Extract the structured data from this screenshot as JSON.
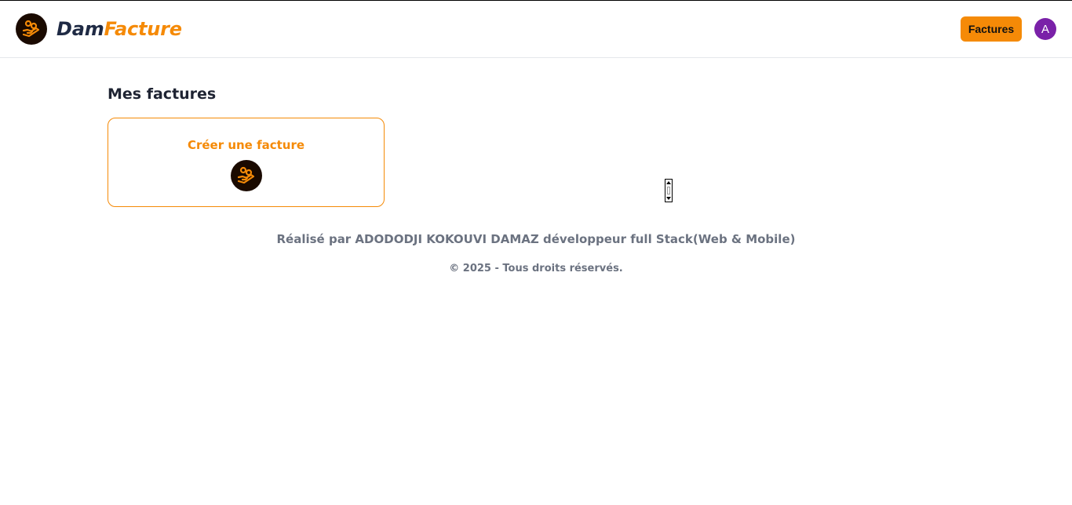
{
  "brand": {
    "name_part1": "Dam",
    "name_part2": "Facture",
    "logo_icon": "hand-coins-icon"
  },
  "navbar": {
    "factures_button": "Factures",
    "avatar_initial": "A"
  },
  "main": {
    "title": "Mes factures",
    "create_card": {
      "label": "Créer une facture",
      "icon": "hand-coins-icon"
    }
  },
  "footer": {
    "credit": "Réalisé par ADODODJI KOKOUVI DAMAZ développeur full Stack(Web & Mobile)",
    "copyright": "© 2025 - Tous droits réservés."
  },
  "colors": {
    "accent": "#f58a07",
    "brand_dark": "#1f2a44",
    "logo_bg": "#1a0a00",
    "avatar": "#7a21a8",
    "muted_text": "#6b7280"
  }
}
